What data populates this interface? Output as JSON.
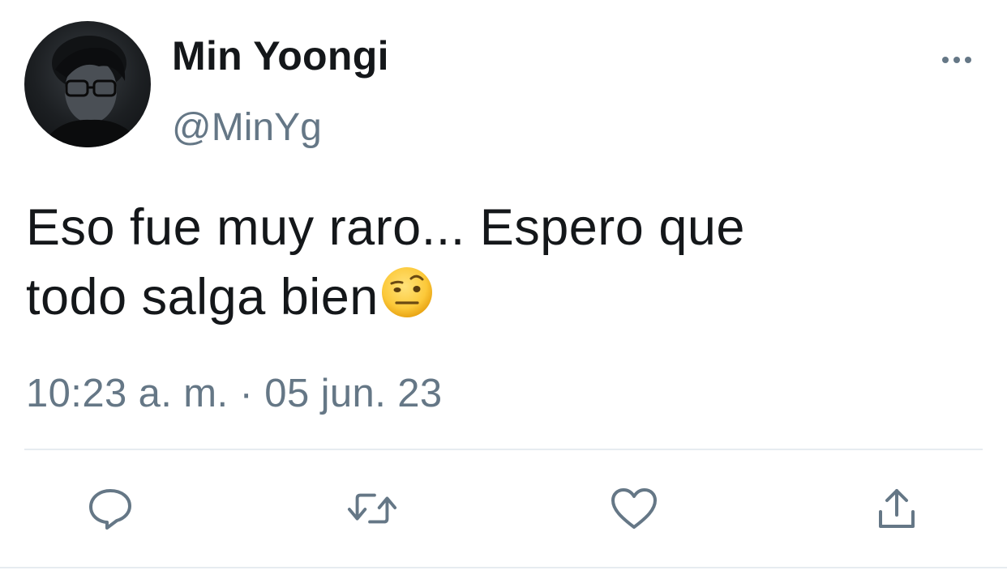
{
  "tweet": {
    "author": {
      "display_name": "Min Yoongi",
      "handle": "@MinYg"
    },
    "text_line1": "Eso fue muy raro... Espero que",
    "text_line2": "todo salga bien",
    "emoji": "face-with-raised-eyebrow",
    "timestamp": "10:23 a. m. · 05 jun. 23"
  },
  "actions": [
    {
      "name": "reply",
      "icon": "speech-bubble-icon"
    },
    {
      "name": "retweet",
      "icon": "retweet-icon"
    },
    {
      "name": "like",
      "icon": "heart-icon"
    },
    {
      "name": "share",
      "icon": "share-icon"
    }
  ],
  "colors": {
    "text_primary": "#14171a",
    "text_secondary": "#657786",
    "divider": "#e6ecf0",
    "icon": "#657786"
  }
}
